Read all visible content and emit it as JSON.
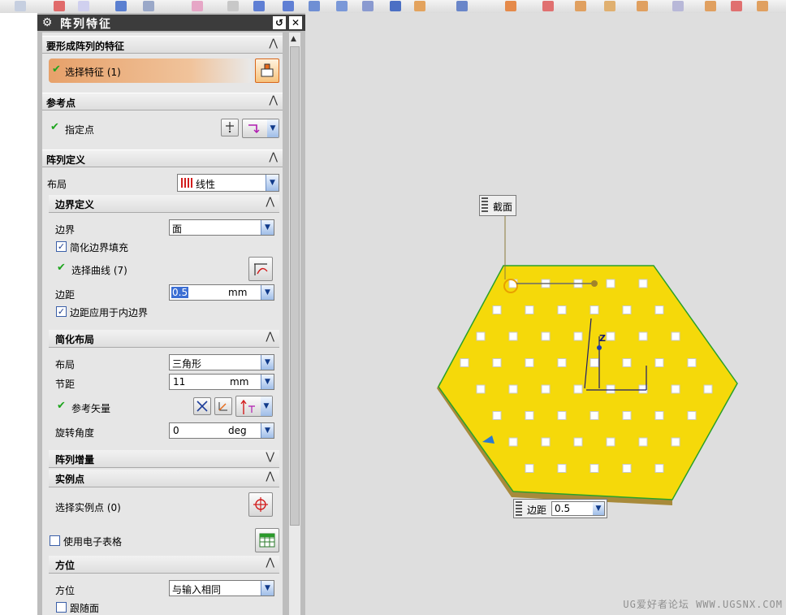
{
  "dialog": {
    "title": "阵列特征",
    "sections": {
      "features": {
        "header": "要形成阵列的特征",
        "select_feature": "选择特征 (1)"
      },
      "reference_point": {
        "header": "参考点",
        "specify_point": "指定点"
      },
      "pattern_definition": {
        "header": "阵列定义",
        "layout_label": "布局",
        "layout_value": "线性",
        "boundary_definition": {
          "header": "边界定义",
          "boundary_label": "边界",
          "boundary_value": "面",
          "simplify_fill_label": "简化边界填充",
          "simplify_fill_checked": true,
          "select_curve": "选择曲线 (7)",
          "margin_label": "边距",
          "margin_value": "0.5",
          "margin_unit": "mm",
          "inner_boundary_label": "边距应用于内边界",
          "inner_boundary_checked": true
        },
        "simplified_layout": {
          "header": "简化布局",
          "layout_label": "布局",
          "layout_value": "三角形",
          "pitch_label": "节距",
          "pitch_value": "11",
          "pitch_unit": "mm",
          "ref_vector_label": "参考矢量",
          "rotation_label": "旋转角度",
          "rotation_value": "0",
          "rotation_unit": "deg"
        },
        "pattern_increment": {
          "header": "阵列增量"
        },
        "instance_points": {
          "header": "实例点",
          "select_label": "选择实例点 (0)"
        },
        "spreadsheet_label": "使用电子表格",
        "spreadsheet_checked": false,
        "orientation": {
          "header": "方位",
          "label": "方位",
          "value": "与输入相同",
          "follow_face_label": "跟随面",
          "follow_face_checked": false
        }
      }
    }
  },
  "viewport": {
    "section_label": "截面",
    "margin_label": "边距",
    "margin_value": "0.5",
    "axis_label": "Z",
    "watermark": "UG爱好者论坛 WWW.UGSNX.COM"
  },
  "colors": {
    "plate": "#f5d90a",
    "accent_orange": "#e8a46a",
    "check_green": "#1ea51e"
  }
}
